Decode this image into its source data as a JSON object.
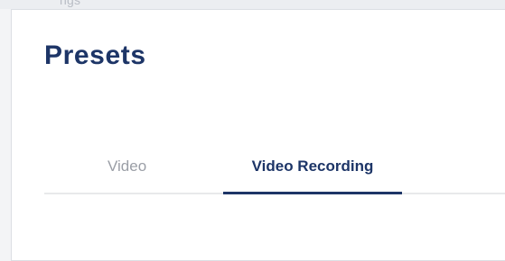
{
  "topbar": {
    "text": "ngs"
  },
  "page": {
    "title": "Presets"
  },
  "tabs": [
    {
      "label": "Video",
      "active": false
    },
    {
      "label": "Video Recording",
      "active": true
    }
  ],
  "colors": {
    "accent": "#1d3567",
    "inactive_tab": "#9a9ea6",
    "background": "#f3f4f6",
    "card": "#ffffff"
  }
}
